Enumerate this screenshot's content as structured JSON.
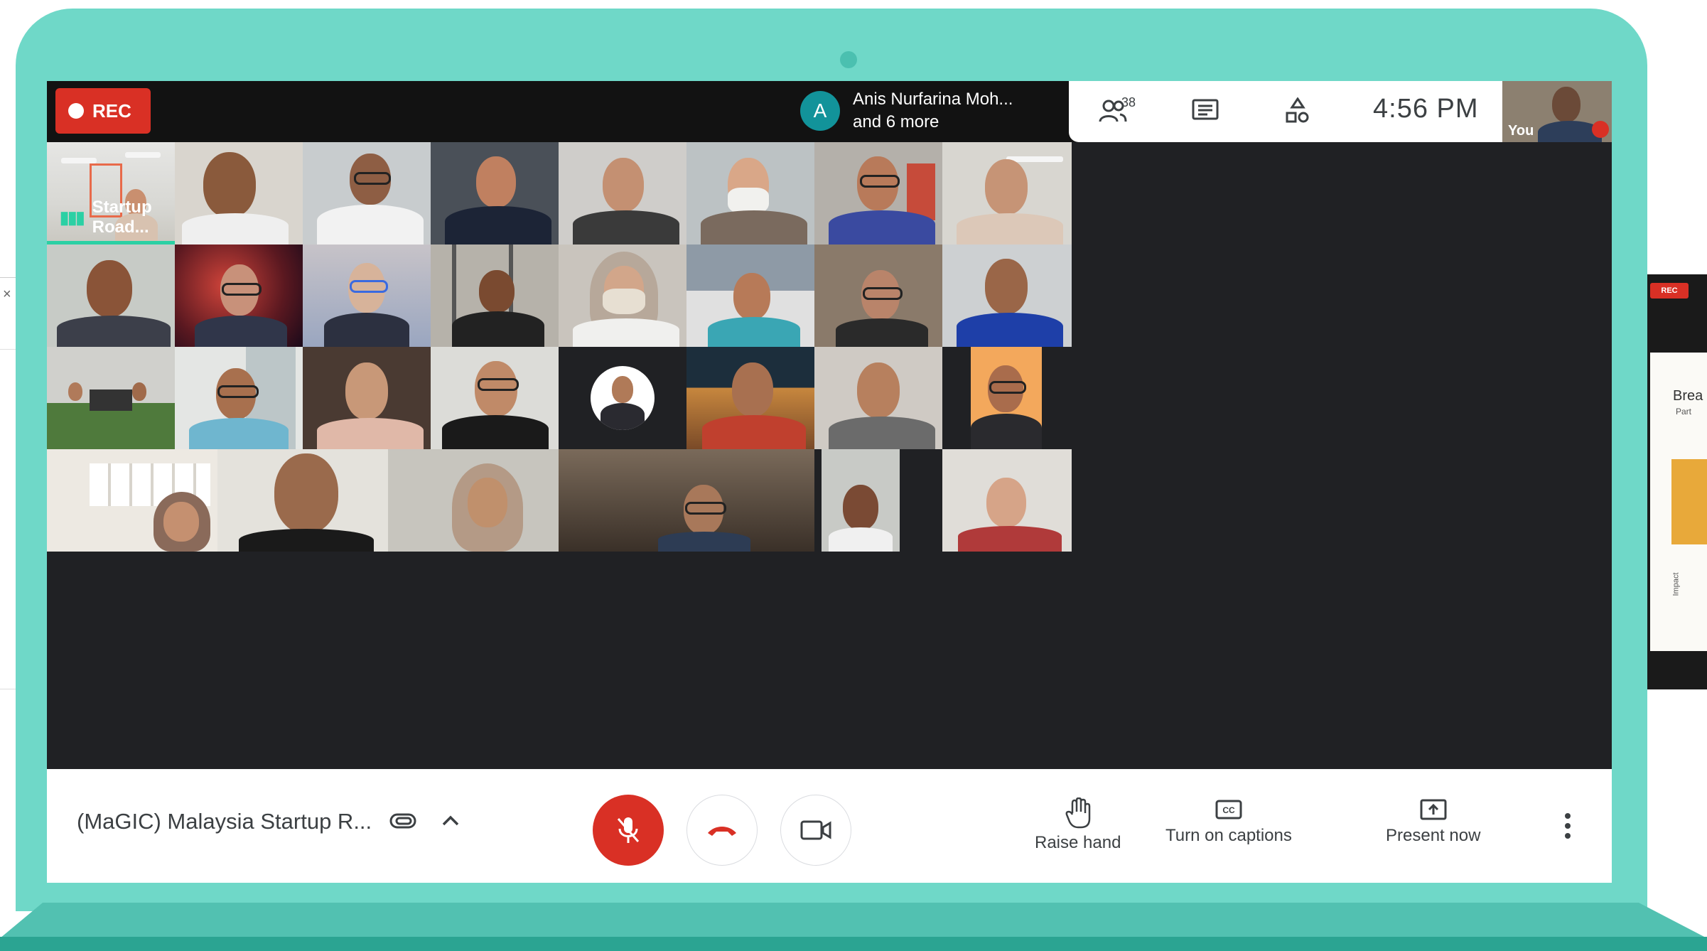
{
  "recording": {
    "label": "REC"
  },
  "presenter": {
    "initial": "A",
    "line1": "Anis Nurfarina Moh...",
    "line2": "and 6 more"
  },
  "header": {
    "participant_count": "38",
    "time": "4:56 PM"
  },
  "self_view": {
    "label": "You"
  },
  "tiles": {
    "first_label": "Startup Road..."
  },
  "meeting": {
    "title": "(MaGIC) Malaysia Startup R..."
  },
  "controls": {
    "raise_hand": "Raise hand",
    "captions": "Turn on captions",
    "present": "Present now"
  },
  "side_window": {
    "rec_label": "REC",
    "slide_title": "Brea",
    "slide_subtitle": "Part",
    "axis_label": "Impact"
  },
  "colors": {
    "frame": "#6fd8c8",
    "rec": "#d93025",
    "speaking": "#2bd0a4",
    "avatar": "#12939a"
  },
  "icons": [
    "participants-icon",
    "chat-icon",
    "activities-icon",
    "mic-off-icon",
    "hang-up-icon",
    "camera-icon",
    "raise-hand-icon",
    "captions-icon",
    "present-icon",
    "more-vert-icon",
    "attachment-icon",
    "chevron-up-icon"
  ]
}
